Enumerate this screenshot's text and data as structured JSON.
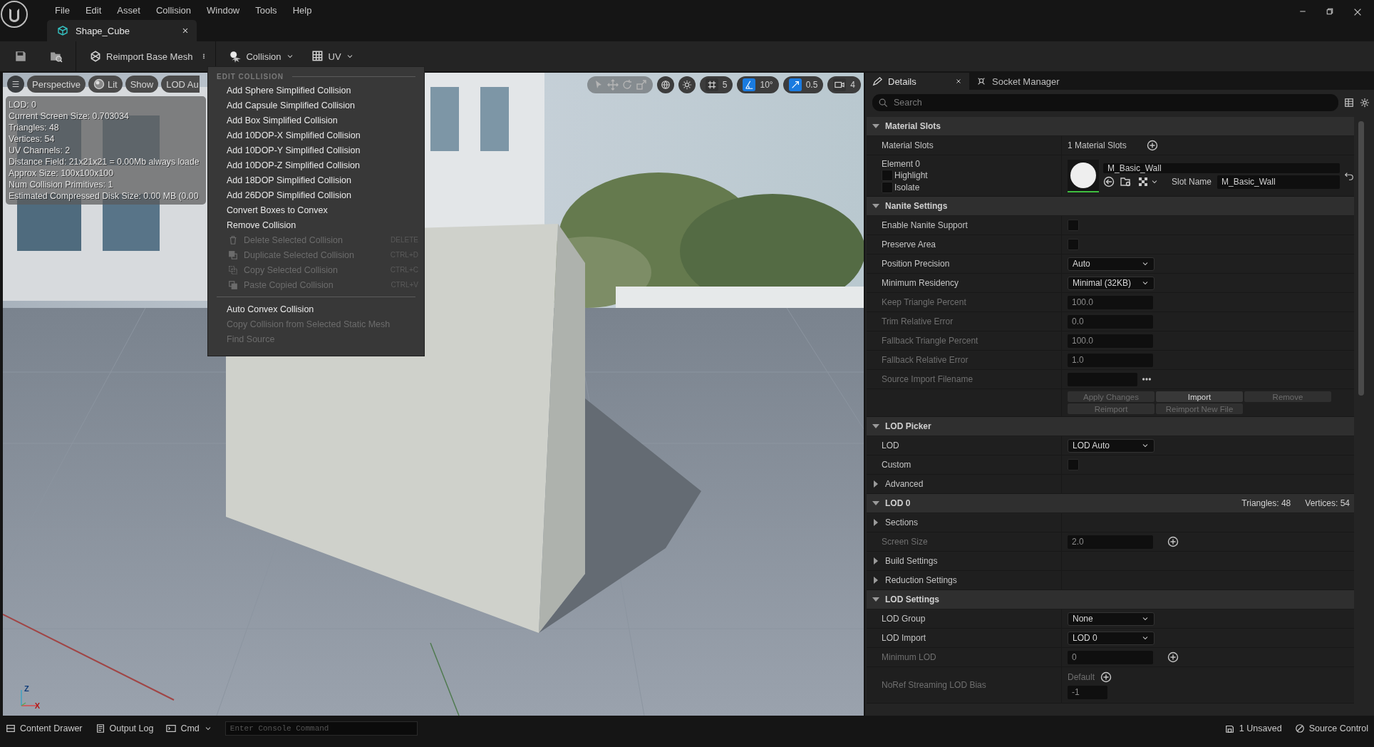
{
  "menu_bar": [
    "File",
    "Edit",
    "Asset",
    "Collision",
    "Window",
    "Tools",
    "Help"
  ],
  "document_tab": "Shape_Cube",
  "toolbar": {
    "reimport_button": "Reimport Base Mesh",
    "collision_menu": "Collision",
    "uv_menu": "UV"
  },
  "viewport": {
    "view_buttons": [
      {
        "kind": "plain",
        "label": "Perspective"
      },
      {
        "kind": "lit",
        "label": "Lit"
      },
      {
        "kind": "plain",
        "label": "Show"
      },
      {
        "kind": "plain",
        "label": "LOD Au"
      }
    ],
    "snap_tools": [
      {
        "kind": "grid",
        "value": "5",
        "on": false
      },
      {
        "kind": "rotation",
        "value": "10°",
        "on": true
      },
      {
        "kind": "scale",
        "value": "0.5",
        "on": true
      },
      {
        "kind": "camera",
        "value": "4",
        "on": false
      }
    ],
    "stats": [
      "LOD: 0",
      "Current Screen Size: 0.703034",
      "Triangles: 48",
      "Vertices: 54",
      "UV Channels: 2",
      "Distance Field: 21x21x21 = 0.00Mb always loade",
      "Approx Size: 100x100x100",
      "Num Collision Primitives: 1",
      "Estimated Compressed Disk Size: 0.00 MB (0.00"
    ],
    "axis_labels": [
      "Z",
      "X"
    ]
  },
  "context_menu": {
    "header": "EDIT COLLISION",
    "items": [
      {
        "kind": "command",
        "label": "Add Sphere Simplified Collision",
        "disabled": false
      },
      {
        "kind": "command",
        "label": "Add Capsule Simplified Collision",
        "disabled": false
      },
      {
        "kind": "command",
        "label": "Add Box Simplified Collision",
        "disabled": false
      },
      {
        "kind": "command",
        "label": "Add 10DOP-X Simplified Collision",
        "disabled": false
      },
      {
        "kind": "command",
        "label": "Add 10DOP-Y Simplified Collision",
        "disabled": false
      },
      {
        "kind": "command",
        "label": "Add 10DOP-Z Simplified Collision",
        "disabled": false
      },
      {
        "kind": "command",
        "label": "Add 18DOP Simplified Collision",
        "disabled": false
      },
      {
        "kind": "command",
        "label": "Add 26DOP Simplified Collision",
        "disabled": false
      },
      {
        "kind": "command",
        "label": "Convert Boxes to Convex",
        "disabled": false
      },
      {
        "kind": "command",
        "label": "Remove Collision",
        "disabled": false
      },
      {
        "kind": "delete",
        "label": "Delete Selected Collision",
        "shortcut": "DELETE",
        "disabled": true
      },
      {
        "kind": "duplicate",
        "label": "Duplicate Selected Collision",
        "shortcut": "CTRL+D",
        "disabled": true
      },
      {
        "kind": "copy",
        "label": "Copy Selected Collision",
        "shortcut": "CTRL+C",
        "disabled": true
      },
      {
        "kind": "paste",
        "label": "Paste Copied Collision",
        "shortcut": "CTRL+V",
        "disabled": true
      },
      {
        "kind": "separator"
      },
      {
        "kind": "command",
        "label": "Auto Convex Collision",
        "disabled": false
      },
      {
        "kind": "command",
        "label": "Copy Collision from Selected Static Mesh",
        "disabled": true
      },
      {
        "kind": "command",
        "label": "Find Source",
        "disabled": true
      }
    ]
  },
  "details": {
    "tabs": [
      {
        "label": "Details",
        "selected": true
      },
      {
        "label": "Socket Manager",
        "selected": false
      }
    ],
    "search": {
      "placeholder": "Search"
    },
    "sections": [
      {
        "title": "Material Slots",
        "expanded": true,
        "rows": [
          {
            "kind": "count",
            "label": "Material Slots",
            "value": "1 Material Slots"
          },
          {
            "kind": "material",
            "label": "Element 0",
            "options": [
              {
                "label": "Highlight",
                "checked": false
              },
              {
                "label": "Isolate",
                "checked": false
              }
            ],
            "material": "M_Basic_Wall",
            "slot_label": "Slot Name",
            "slot_value": "M_Basic_Wall"
          }
        ]
      },
      {
        "title": "Nanite Settings",
        "expanded": true,
        "rows": [
          {
            "kind": "checkbox",
            "label": "Enable Nanite Support",
            "checked": false
          },
          {
            "kind": "checkbox",
            "label": "Preserve Area",
            "checked": false
          },
          {
            "kind": "dropdown",
            "label": "Position Precision",
            "value": "Auto"
          },
          {
            "kind": "dropdown",
            "label": "Minimum Residency",
            "value": "Minimal (32KB)"
          },
          {
            "kind": "number",
            "label": "Keep Triangle Percent",
            "value": "100.0",
            "disabled": true
          },
          {
            "kind": "number",
            "label": "Trim Relative Error",
            "value": "0.0",
            "disabled": true
          },
          {
            "kind": "number",
            "label": "Fallback Triangle Percent",
            "value": "100.0",
            "disabled": true
          },
          {
            "kind": "number",
            "label": "Fallback Relative Error",
            "value": "1.0",
            "disabled": true
          },
          {
            "kind": "file",
            "label": "Source Import Filename",
            "disabled": true
          },
          {
            "kind": "buttons",
            "buttons": [
              {
                "label": "Apply Changes",
                "disabled": true
              },
              {
                "label": "Import",
                "disabled": false
              },
              {
                "label": "Remove",
                "disabled": true
              },
              {
                "label": "Reimport",
                "disabled": true
              },
              {
                "label": "Reimport New File",
                "disabled": true
              }
            ]
          }
        ]
      },
      {
        "title": "LOD Picker",
        "expanded": true,
        "rows": [
          {
            "kind": "dropdown",
            "label": "LOD",
            "value": "LOD Auto"
          },
          {
            "kind": "checkbox",
            "label": "Custom",
            "checked": false
          },
          {
            "kind": "group",
            "label": "Advanced",
            "expanded": false
          }
        ]
      },
      {
        "title": "LOD 0",
        "expanded": true,
        "stats": [
          "Triangles: 48",
          "Vertices: 54"
        ],
        "rows": [
          {
            "kind": "group",
            "label": "Sections",
            "expanded": false
          },
          {
            "kind": "number",
            "label": "Screen Size",
            "value": "2.0",
            "disabled": true,
            "add_button": true
          },
          {
            "kind": "group",
            "label": "Build Settings",
            "expanded": false
          },
          {
            "kind": "group",
            "label": "Reduction Settings",
            "expanded": false
          }
        ]
      },
      {
        "title": "LOD Settings",
        "expanded": true,
        "rows": [
          {
            "kind": "dropdown",
            "label": "LOD Group",
            "value": "None"
          },
          {
            "kind": "dropdown",
            "label": "LOD Import",
            "value": "LOD 0"
          },
          {
            "kind": "number",
            "label": "Minimum LOD",
            "value": "0",
            "disabled": true,
            "add_button": true
          },
          {
            "kind": "bias",
            "label": "NoRef Streaming LOD Bias",
            "default_label": "Default",
            "value": "-1",
            "disabled": true
          }
        ]
      }
    ]
  },
  "status_bar": {
    "content_drawer": "Content Drawer",
    "output_log": "Output Log",
    "cmd": "Cmd",
    "console_placeholder": "Enter Console Command",
    "unsaved": "1 Unsaved",
    "source_control": "Source Control"
  }
}
